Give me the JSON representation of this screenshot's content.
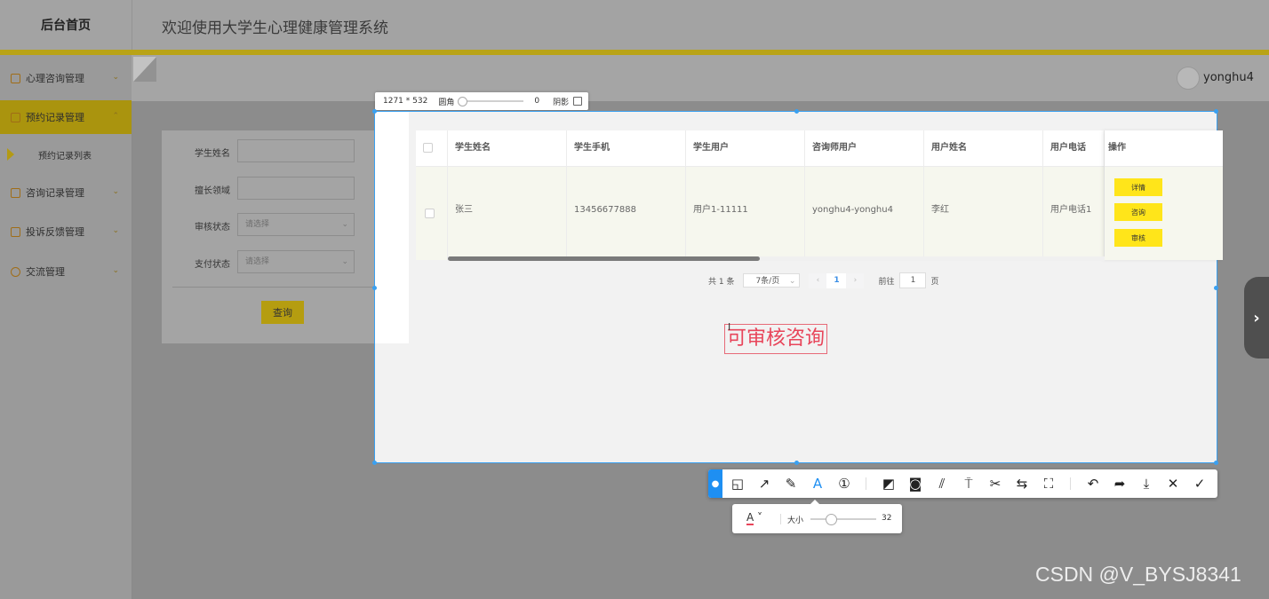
{
  "header": {
    "home_label": "后台首页",
    "system_title": "欢迎使用大学生心理健康管理系统",
    "username": "yonghu4"
  },
  "sidebar": {
    "items": [
      {
        "label": "心理咨询管理"
      },
      {
        "label": "预约记录管理"
      },
      {
        "label": "咨询记录管理"
      },
      {
        "label": "投诉反馈管理"
      },
      {
        "label": "交流管理"
      }
    ],
    "sub_item": "预约记录列表"
  },
  "search_form": {
    "student_name_label": "学生姓名",
    "specialty_label": "擅长领域",
    "review_status_label": "审核状态",
    "review_status_placeholder": "请选择",
    "pay_status_label": "支付状态",
    "pay_status_placeholder": "请选择",
    "query_button": "查询"
  },
  "capture": {
    "size_text": "1271 * 532",
    "corner_label": "圆角",
    "corner_value": "0",
    "shadow_label": "阴影"
  },
  "table": {
    "headers": [
      "学生姓名",
      "学生手机",
      "学生用户",
      "咨询师用户",
      "用户姓名",
      "用户电话",
      "操作"
    ],
    "rows": [
      {
        "student_name": "张三",
        "student_phone": "13456677888",
        "student_user": "用户1-11111",
        "counselor_user": "yonghu4-yonghu4",
        "user_name": "李红",
        "user_phone": "用户电话1"
      }
    ],
    "actions": [
      "详情",
      "咨询",
      "审核"
    ]
  },
  "pagination": {
    "total_text": "共 1 条",
    "page_size": "7条/页",
    "current_page": "1",
    "goto_label": "前往",
    "goto_value": "1",
    "goto_suffix": "页"
  },
  "annotation_text": "可审核咨询",
  "font_panel": {
    "font_icon": "A",
    "size_label": "大小",
    "size_value": "32"
  },
  "watermark": "CSDN @V_BYSJ8341",
  "colors": {
    "accent_yellow": "#ffe51a",
    "selection_blue": "#3aa0f0",
    "annotation_red": "#e8455a"
  }
}
